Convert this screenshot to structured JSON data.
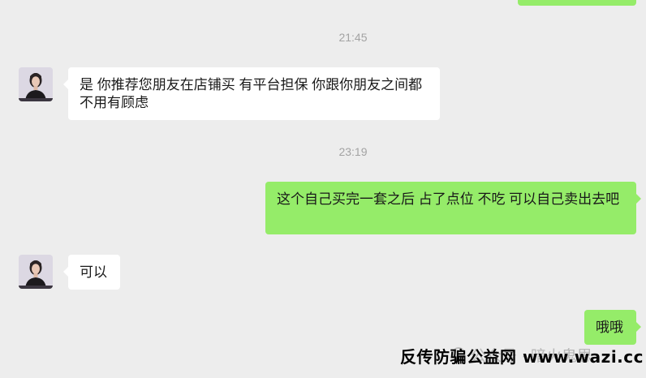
{
  "chat": {
    "messages": [
      {
        "type": "time",
        "text": "21:45"
      },
      {
        "type": "in",
        "text": "是  你推荐您朋友在店铺买  有平台担保 你跟你朋友之间都不用有顾虑"
      },
      {
        "type": "time",
        "text": "23:19"
      },
      {
        "type": "out",
        "text": "这个自己买完一套之后   占了点位   不吃  可以自己卖出去吧"
      },
      {
        "type": "in",
        "text": "可以"
      },
      {
        "type": "out",
        "text": "哦哦"
      }
    ]
  },
  "watermark": {
    "text": "反传防骗公益网 www.wazi.cc",
    "ghost_text": "公众号 · 暗火鬼思"
  },
  "colors": {
    "background": "#ededed",
    "incoming_bubble": "#ffffff",
    "outgoing_bubble": "#95ec69",
    "timestamp": "#a3a3a3"
  }
}
